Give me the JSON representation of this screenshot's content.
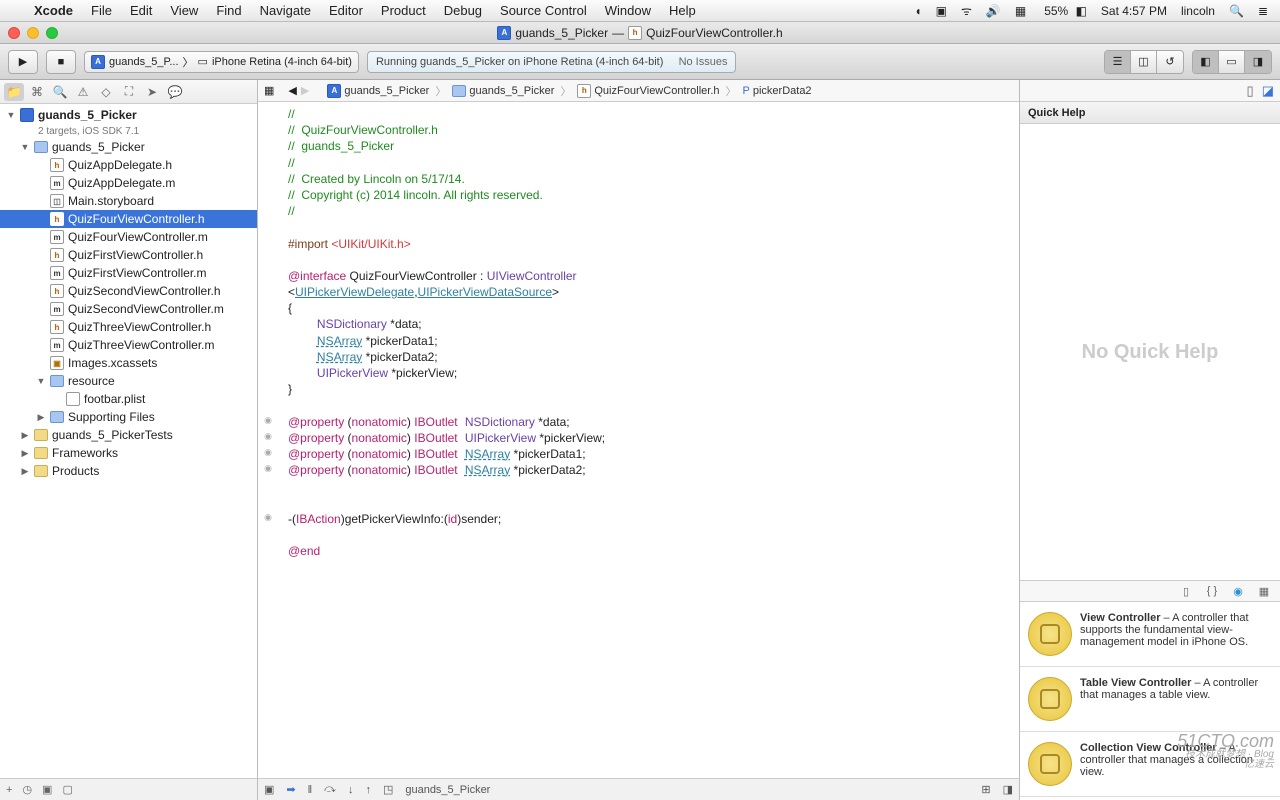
{
  "menubar": {
    "app": "Xcode",
    "items": [
      "File",
      "Edit",
      "View",
      "Find",
      "Navigate",
      "Editor",
      "Product",
      "Debug",
      "Source Control",
      "Window",
      "Help"
    ],
    "battery": "55%",
    "clock": "Sat 4:57 PM",
    "user": "lincoln"
  },
  "window": {
    "title_left": "guands_5_Picker",
    "title_sep": "—",
    "title_right": "QuizFourViewController.h"
  },
  "toolbar": {
    "scheme": "guands_5_P...",
    "destination": "iPhone Retina (4-inch 64-bit)",
    "activity": "Running guands_5_Picker on iPhone Retina (4-inch 64-bit)",
    "issues": "No Issues"
  },
  "navigator": {
    "project": "guands_5_Picker",
    "project_sub": "2 targets, iOS SDK 7.1",
    "tree": [
      {
        "d": 1,
        "t": "folder",
        "open": true,
        "n": "guands_5_Picker"
      },
      {
        "d": 2,
        "t": "h",
        "n": "QuizAppDelegate.h"
      },
      {
        "d": 2,
        "t": "m",
        "n": "QuizAppDelegate.m"
      },
      {
        "d": 2,
        "t": "sb",
        "n": "Main.storyboard"
      },
      {
        "d": 2,
        "t": "h",
        "n": "QuizFourViewController.h",
        "sel": true
      },
      {
        "d": 2,
        "t": "m",
        "n": "QuizFourViewController.m"
      },
      {
        "d": 2,
        "t": "h",
        "n": "QuizFirstViewController.h"
      },
      {
        "d": 2,
        "t": "m",
        "n": "QuizFirstViewController.m"
      },
      {
        "d": 2,
        "t": "h",
        "n": "QuizSecondViewController.h"
      },
      {
        "d": 2,
        "t": "m",
        "n": "QuizSecondViewController.m"
      },
      {
        "d": 2,
        "t": "h",
        "n": "QuizThreeViewController.h"
      },
      {
        "d": 2,
        "t": "m",
        "n": "QuizThreeViewController.m"
      },
      {
        "d": 2,
        "t": "xc",
        "n": "Images.xcassets"
      },
      {
        "d": 2,
        "t": "folder",
        "open": true,
        "n": "resource"
      },
      {
        "d": 3,
        "t": "pl",
        "n": "footbar.plist"
      },
      {
        "d": 2,
        "t": "folder",
        "open": false,
        "n": "Supporting Files"
      },
      {
        "d": 1,
        "t": "folderY",
        "open": false,
        "n": "guands_5_PickerTests"
      },
      {
        "d": 1,
        "t": "folderY",
        "open": false,
        "n": "Frameworks"
      },
      {
        "d": 1,
        "t": "folderY",
        "open": false,
        "n": "Products"
      }
    ]
  },
  "jumpbar": {
    "parts": [
      "guands_5_Picker",
      "guands_5_Picker",
      "QuizFourViewController.h",
      "pickerData2"
    ]
  },
  "code": {
    "l1": "//",
    "l2": "//  QuizFourViewController.h",
    "l3": "//  guands_5_Picker",
    "l4": "//",
    "l5": "//  Created by Lincoln on 5/17/14.",
    "l6": "//  Copyright (c) 2014 lincoln. All rights reserved.",
    "l7": "//",
    "l8": "",
    "imp_kw": "#import",
    "imp_val": " <UIKit/UIKit.h>",
    "int_kw": "@interface",
    "int_cls": " QuizFourViewController : ",
    "uivc": "UIViewController",
    "prot_open": "<",
    "prot1": "UIPickerViewDelegate",
    "prot_comma": ",",
    "prot2": "UIPickerViewDataSource",
    "prot_close": ">",
    "brace_o": "{",
    "i1_t": "NSDictionary",
    "i1_r": " *data;",
    "i2_t": "NSArray",
    "i2_r": " *pickerData1;",
    "i3_t": "NSArray",
    "i3_r": " *pickerData2;",
    "i4_t": "UIPickerView",
    "i4_r": " *pickerView;",
    "brace_c": "}",
    "prop_kw": "@property",
    "prop_attr": " (",
    "nonat": "nonatomic",
    "prop_attr2": ") ",
    "iboutlet": "IBOutlet",
    "p1_t": "NSDictionary",
    "p1_r": " *data;",
    "p2_t": "UIPickerView",
    "p2_r": " *pickerView;",
    "p3_t": "NSArray",
    "p3_r": " *pickerData1;",
    "p4_t": "NSArray",
    "p4_r": " *pickerData2;",
    "act_dash": "-(",
    "ibaction": "IBAction",
    "act_m": ")getPickerViewInfo:(",
    "id": "id",
    "act_r": ")sender;",
    "end": "@end"
  },
  "debugbar": {
    "target": "guands_5_Picker"
  },
  "quickhelp": {
    "title": "Quick Help",
    "empty": "No Quick Help"
  },
  "library": {
    "items": [
      {
        "title": "View Controller",
        "desc": " – A controller that supports the fundamental view-management model in iPhone OS."
      },
      {
        "title": "Table View Controller",
        "desc": " – A controller that manages a table view."
      },
      {
        "title": "Collection View Controller",
        "desc": " – A controller that manages a collection view."
      }
    ]
  },
  "watermark": {
    "big": "51CTO.com",
    "sm1": "技术成就梦想 · Blog",
    "sm2": "亿速云"
  }
}
